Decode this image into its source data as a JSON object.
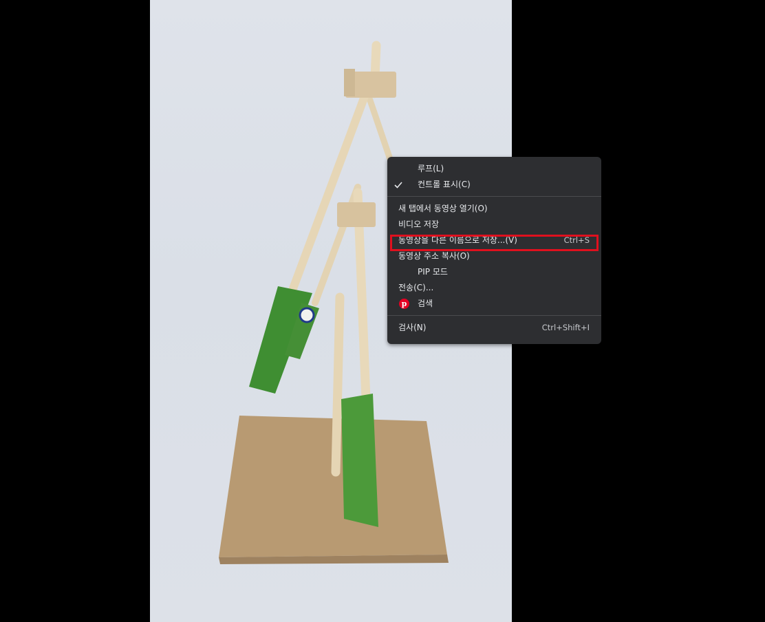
{
  "context_menu": {
    "items": [
      {
        "label": "루프(L)",
        "shortcut": ""
      },
      {
        "label": "컨트롤 표시(C)",
        "shortcut": "",
        "checked": true
      },
      {
        "label": "새 탭에서 동영상 열기(O)",
        "shortcut": ""
      },
      {
        "label": "비디오 저장",
        "shortcut": ""
      },
      {
        "label": "동영상을 다른 이름으로 저장...(V)",
        "shortcut": "Ctrl+S",
        "highlighted": true
      },
      {
        "label": "동영상 주소 복사(O)",
        "shortcut": ""
      },
      {
        "label": "PIP 모드",
        "shortcut": ""
      },
      {
        "label": "전송(C)...",
        "shortcut": ""
      },
      {
        "label": "검색",
        "shortcut": "",
        "icon": "pinterest-icon"
      },
      {
        "label": "검사(N)",
        "shortcut": "Ctrl+Shift+I"
      }
    ]
  },
  "colors": {
    "menu_background": "#2d2e31",
    "menu_text": "#e8eaed",
    "highlight_border": "#e0101e",
    "pinterest_red": "#e60023",
    "letterbox": "#000000"
  },
  "icons": {
    "check": "checkmark-icon",
    "pinterest": "pinterest-icon"
  }
}
